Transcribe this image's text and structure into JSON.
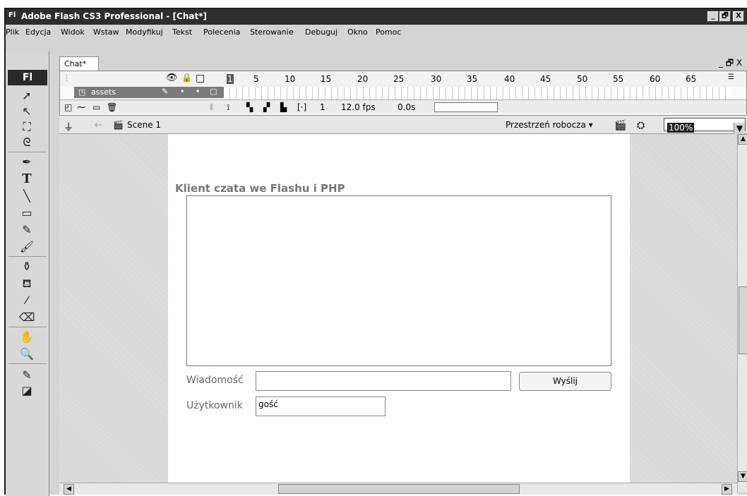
{
  "window": {
    "app_badge": "Fl",
    "title": "Adobe Flash CS3 Professional - [Chat*]",
    "minimize": "_",
    "restore": "🗗",
    "close": "X"
  },
  "menu": [
    "Plik",
    "Edycja",
    "Widok",
    "Wstaw",
    "Modyfikuj",
    "Tekst",
    "Polecenia",
    "Sterowanie",
    "Debuguj",
    "Okno",
    "Pomoc"
  ],
  "toolbox": {
    "logo": "Fl"
  },
  "document": {
    "tab": "Chat*",
    "controls": "_ 🗗 X"
  },
  "timeline": {
    "frame_numbers": [
      "1",
      "5",
      "10",
      "15",
      "20",
      "25",
      "30",
      "35",
      "40",
      "45",
      "50",
      "55",
      "60",
      "65"
    ],
    "layer_name": "assets",
    "current_frame": "1",
    "fps": "12.0 fps",
    "time": "0.0s"
  },
  "scene": {
    "name": "Scene 1",
    "workspace": "Przestrzeń robocza ▾",
    "zoom": "100%"
  },
  "stage": {
    "title": "Klient czata we Flashu i PHP",
    "message_label": "Wiadomość",
    "message_value": "",
    "send_button": "Wyślij",
    "user_label": "Użytkownik",
    "user_value": "gość"
  }
}
